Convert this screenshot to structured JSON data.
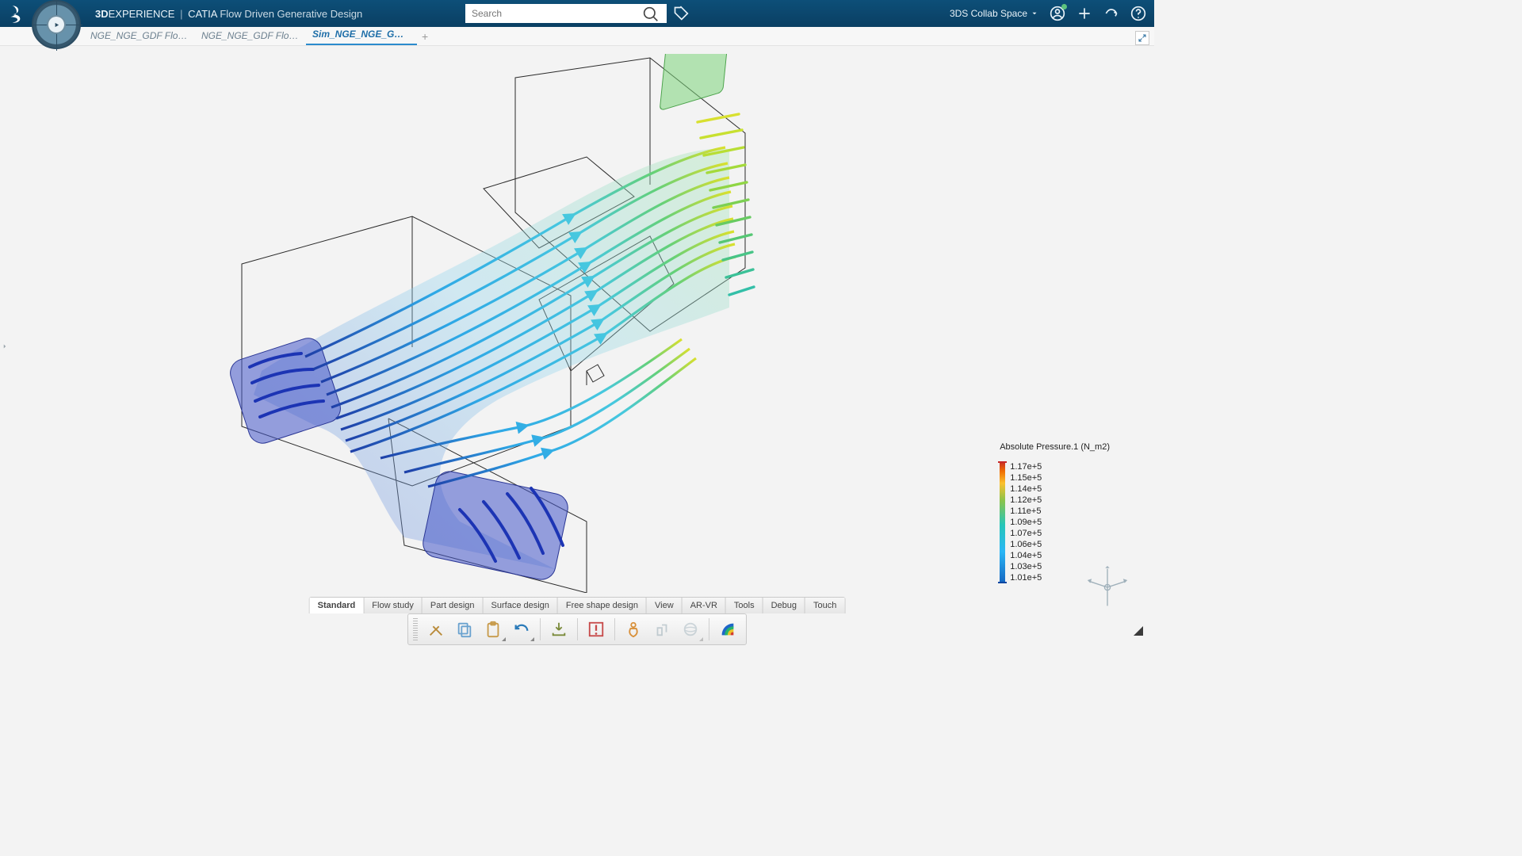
{
  "header": {
    "brand_bold": "3D",
    "brand_rest": "EXPERIENCE",
    "brand_sep": "|",
    "brand_app": "CATIA",
    "brand_sub": "Flow Driven Generative Design",
    "search_placeholder": "Search",
    "collab_space": "3DS Collab Space"
  },
  "tabs": [
    {
      "label": "NGE_NGE_GDF Flowsplitter",
      "active": false
    },
    {
      "label": "NGE_NGE_GDF Flowsplitter",
      "active": false
    },
    {
      "label": "Sim_NGE_NGE_GDF Flowsp",
      "active": true
    }
  ],
  "legend": {
    "title": "Absolute Pressure.1 (N_m2)",
    "values": [
      "1.17e+5",
      "1.15e+5",
      "1.14e+5",
      "1.12e+5",
      "1.11e+5",
      "1.09e+5",
      "1.07e+5",
      "1.06e+5",
      "1.04e+5",
      "1.03e+5",
      "1.01e+5"
    ]
  },
  "tool_tabs": [
    {
      "label": "Standard",
      "active": true
    },
    {
      "label": "Flow study"
    },
    {
      "label": "Part design"
    },
    {
      "label": "Surface design"
    },
    {
      "label": "Free shape design"
    },
    {
      "label": "View"
    },
    {
      "label": "AR-VR"
    },
    {
      "label": "Tools"
    },
    {
      "label": "Debug"
    },
    {
      "label": "Touch"
    }
  ]
}
